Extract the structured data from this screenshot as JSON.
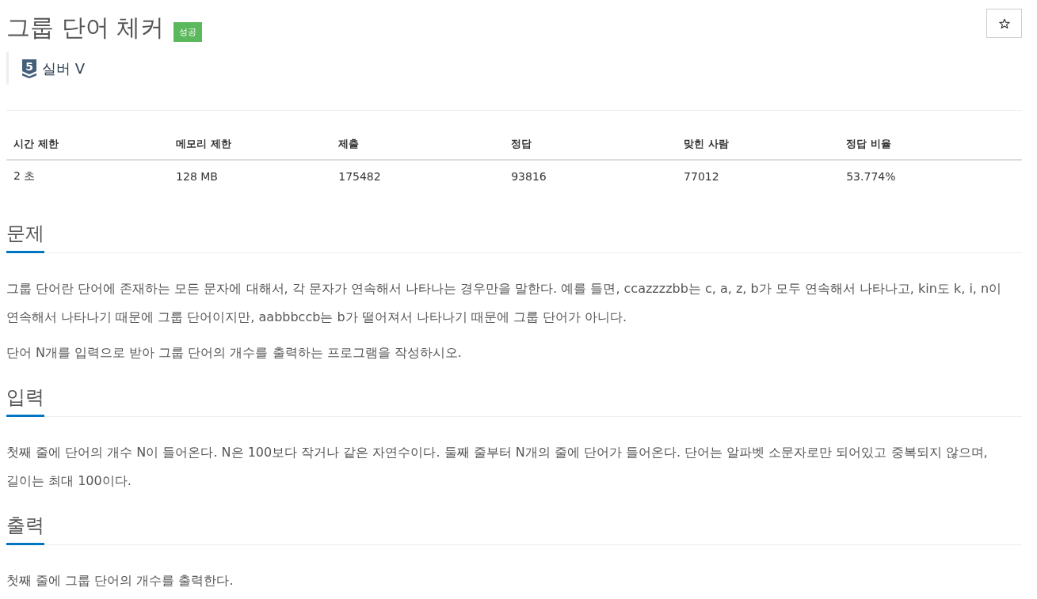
{
  "title": "그룹 단어 체커",
  "result_badge": "성공",
  "tier": {
    "number": "5",
    "label": "실버 V"
  },
  "stats_table": {
    "columns": [
      "시간 제한",
      "메모리 제한",
      "제출",
      "정답",
      "맞힌 사람",
      "정답 비율"
    ],
    "rows": [
      [
        "2 초",
        "128 MB",
        "175482",
        "93816",
        "77012",
        "53.774%"
      ]
    ]
  },
  "sections": [
    {
      "heading": "문제",
      "paragraphs": [
        "그룹 단어란 단어에 존재하는 모든 문자에 대해서, 각 문자가 연속해서 나타나는 경우만을 말한다. 예를 들면, ccazzzzbb는 c, a, z, b가 모두 연속해서 나타나고, kin도 k, i, n이 연속해서 나타나기 때문에 그룹 단어이지만, aabbbccb는 b가 떨어져서 나타나기 때문에 그룹 단어가 아니다.",
        "단어 N개를 입력으로 받아 그룹 단어의 개수를 출력하는 프로그램을 작성하시오."
      ]
    },
    {
      "heading": "입력",
      "paragraphs": [
        "첫째 줄에 단어의 개수 N이 들어온다. N은 100보다 작거나 같은 자연수이다. 둘째 줄부터 N개의 줄에 단어가 들어온다. 단어는 알파벳 소문자로만 되어있고 중복되지 않으며, 길이는 최대 100이다."
      ]
    },
    {
      "heading": "출력",
      "paragraphs": [
        "첫째 줄에 그룹 단어의 개수를 출력한다."
      ]
    }
  ]
}
